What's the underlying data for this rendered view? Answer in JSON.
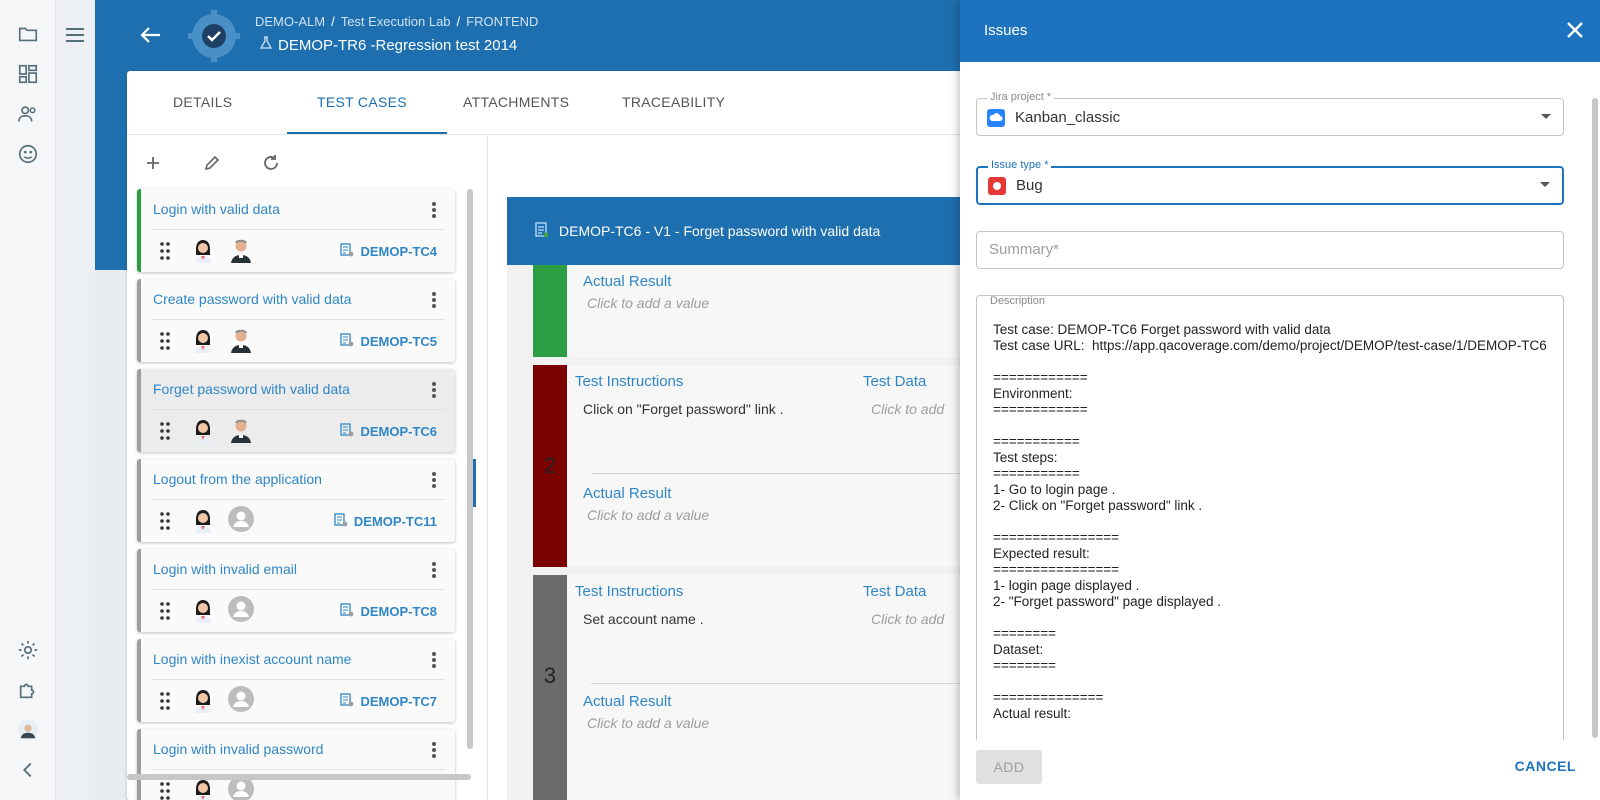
{
  "breadcrumb": [
    "DEMO-ALM",
    "Test Execution Lab",
    "FRONTEND"
  ],
  "page_title": "DEMOP-TR6 -Regression test 2014",
  "tabs": [
    {
      "label": "DETAILS"
    },
    {
      "label": "TEST CASES"
    },
    {
      "label": "ATTACHMENTS"
    },
    {
      "label": "TRACEABILITY"
    }
  ],
  "test_cases": [
    {
      "name": "Login with valid data",
      "id": "DEMOP-TC4"
    },
    {
      "name": "Create password with valid data",
      "id": "DEMOP-TC5"
    },
    {
      "name": "Forget password with valid data",
      "id": "DEMOP-TC6"
    },
    {
      "name": "Logout from the application",
      "id": "DEMOP-TC11"
    },
    {
      "name": "Login with invalid email",
      "id": "DEMOP-TC8"
    },
    {
      "name": "Login with inexist account name",
      "id": "DEMOP-TC7"
    },
    {
      "name": "Login with invalid password",
      "id": ""
    }
  ],
  "detail": {
    "header": "DEMOP-TC6 - V1 - Forget password with valid data",
    "actual_result_label": "Actual Result",
    "placeholder": "Click to add a value",
    "placeholder_short": "Click to add",
    "instructions_label": "Test Instructions",
    "data_label": "Test Data",
    "steps": [
      {
        "number": "2",
        "instruction": "Click on \"Forget password\" link ."
      },
      {
        "number": "3",
        "instruction": "Set account name ."
      }
    ]
  },
  "drawer": {
    "title": "Issues",
    "jira_project_label": "Jira project *",
    "jira_project_value": "Kanban_classic",
    "issue_type_label": "Issue type *",
    "issue_type_value": "Bug",
    "summary_placeholder": "Summary*",
    "description_label": "Description",
    "description_text": "Test case: DEMOP-TC6 Forget password with valid data\nTest case URL:  https://app.qacoverage.com/demo/project/DEMOP/test-case/1/DEMOP-TC6\n\n============\nEnvironment:\n============\n\n===========\nTest steps:\n===========\n1- Go to login page .\n2- Click on \"Forget password\" link .\n\n================\nExpected result:\n================\n1- login page displayed .\n2- \"Forget password\" page displayed .\n\n========\nDataset:\n========\n\n==============\nActual result:",
    "add_label": "ADD",
    "cancel_label": "CANCEL"
  },
  "colors": {
    "primary": "#1e6fb0",
    "pass_green": "#2e9e44",
    "fail_red": "#7b0000",
    "untested_gray": "#6b6b6b",
    "bug_red": "#e53935"
  }
}
